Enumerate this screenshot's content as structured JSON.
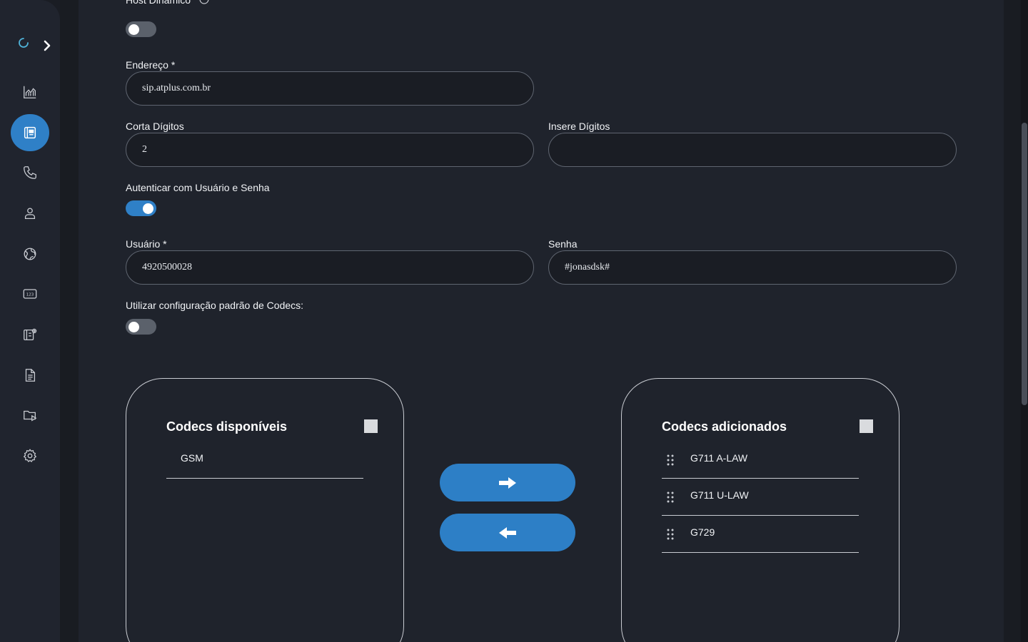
{
  "form": {
    "host_label": "Host Dinâmico",
    "address_label": "Endereço *",
    "address_value": "sip.atplus.com.br",
    "cut_digits_label": "Corta Dígitos",
    "cut_digits_value": "2",
    "insert_digits_label": "Insere Dígitos",
    "insert_digits_value": "",
    "auth_label": "Autenticar com Usuário e Senha",
    "user_label": "Usuário *",
    "user_value": "4920500028",
    "password_label": "Senha",
    "password_value": "#jonasdsk#",
    "default_codecs_label": "Utilizar configuração padrão de Codecs:"
  },
  "toggles": {
    "host_dynamic": false,
    "authenticate": true,
    "default_codecs": false
  },
  "codecs": {
    "available_title": "Codecs disponíveis",
    "available": [
      "GSM"
    ],
    "added_title": "Codecs adicionados",
    "added": [
      "G711 A-LAW",
      "G711 U-LAW",
      "G729"
    ]
  },
  "sidebar": {
    "items": [
      "chart-icon",
      "phonebook-icon",
      "phone-icon",
      "user-icon",
      "globe-icon",
      "keypad-123-icon",
      "contact-settings-icon",
      "document-icon",
      "folder-play-icon",
      "gear-icon"
    ],
    "active": "phonebook-icon"
  },
  "colors": {
    "accent": "#2f80c7",
    "background": "#1f232c",
    "sidebar": "#20242e"
  }
}
